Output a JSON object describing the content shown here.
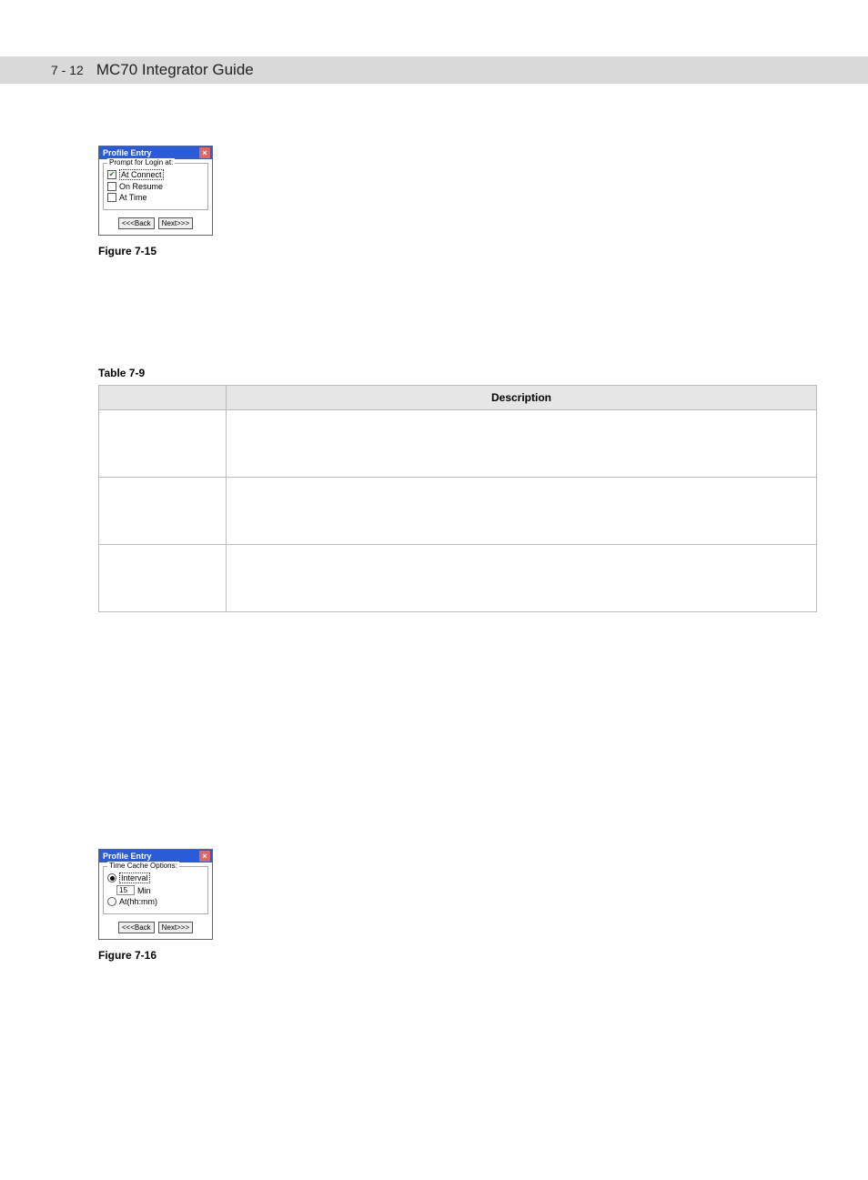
{
  "header": {
    "pagenum": "7 - 12",
    "title": "MC70 Integrator Guide"
  },
  "figure1": {
    "window_title": "Profile Entry",
    "group_label": "Prompt for Login at:",
    "opt1": "At Connect",
    "opt2": "On Resume",
    "opt3": "At Time",
    "btn_back": "<<<Back",
    "btn_next": "Next>>>",
    "caption": "Figure 7-15"
  },
  "table": {
    "caption": "Table 7-9",
    "col1": "",
    "col2": "Description"
  },
  "figure2": {
    "window_title": "Profile Entry",
    "group_label": "Time Cache Options:",
    "opt1": "Interval",
    "input_val": "15",
    "unit": "Min",
    "opt2": "At(hh:mm)",
    "btn_back": "<<<Back",
    "btn_next": "Next>>>",
    "caption": "Figure 7-16"
  }
}
